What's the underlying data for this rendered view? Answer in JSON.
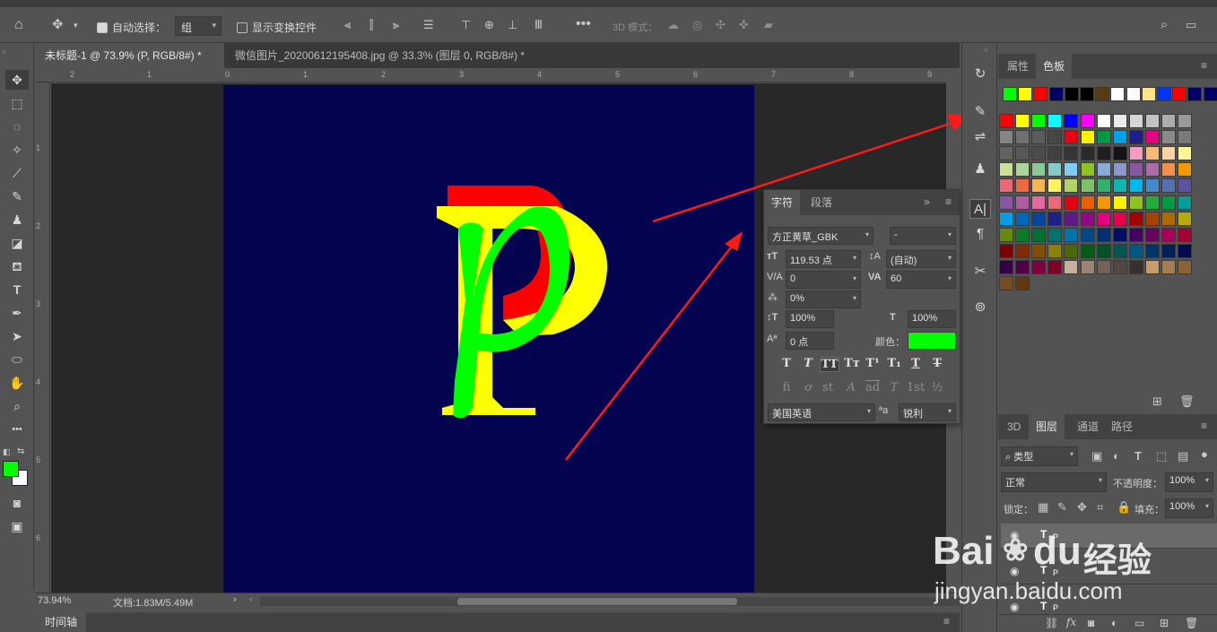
{
  "options_bar": {
    "auto_select_label": "自动选择：",
    "auto_select_value": "组",
    "show_transform_label": "显示变换控件",
    "mode_3d_label": "3D 模式："
  },
  "tabs": [
    {
      "label": "未标题-1 @ 73.9% (P, RGB/8#) *",
      "close": "×"
    },
    {
      "label": "微信图片_20200612195408.jpg @ 33.3% (图层 0, RGB/8#) *",
      "close": "×"
    }
  ],
  "rulers": {
    "h": [
      "2",
      "1",
      "0",
      "1",
      "2",
      "3",
      "4",
      "5",
      "6",
      "7",
      "8",
      "9"
    ],
    "v": [
      "1",
      "2",
      "3",
      "4",
      "5",
      "6"
    ]
  },
  "canvas": {
    "letter": "P",
    "bg_color": "#03034f",
    "colors": {
      "red": "#ff0000",
      "yellow": "#ffff00",
      "green": "#00ff00"
    }
  },
  "status": {
    "zoom": "73.94%",
    "doc": "文档:1.83M/5.49M",
    "arrow": "›"
  },
  "timeline": {
    "label": "时间轴"
  },
  "right_panel": {
    "top_tabs": [
      "属性",
      "色板"
    ],
    "layer_tabs": [
      "3D",
      "图层",
      "通道",
      "路径"
    ],
    "filter_label": "类型",
    "blend_mode": "正常",
    "opacity_label": "不透明度：",
    "opacity_value": "100%",
    "lock_label": "锁定：",
    "fill_label": "填充：",
    "fill_value": "100%",
    "fx_label": "fx"
  },
  "char_panel": {
    "tabs": [
      "字符",
      "段落"
    ],
    "font_family": "方正黄草_GBK",
    "font_style": "-",
    "size": "119.53 点",
    "leading": "(自动)",
    "kerning": "0",
    "tracking": "60",
    "scale_pct": "0%",
    "vscale": "100%",
    "hscale": "100%",
    "baseline": "0 点",
    "color_label": "颜色：",
    "color": "#00ff00",
    "language": "美国英语",
    "aa_label": "ªa",
    "aa_value": "锐利",
    "type_styles": [
      "T",
      "T",
      "TT",
      "Tт",
      "T¹",
      "T₁",
      "T",
      "T"
    ],
    "opentype": [
      "fi",
      "ơ",
      "st",
      "A",
      "ad",
      "T",
      "1st",
      "½"
    ]
  },
  "swatches": {
    "recent": [
      "#00ff00",
      "#ffff00",
      "#ff0000",
      "#000066",
      "#000000",
      "#000000",
      "#5a3a10",
      "#ffffff",
      "#ffffff",
      "#ffe58a",
      "#0033ff",
      "#ff0000",
      "#000066",
      "#000066"
    ],
    "grid": [
      [
        "#ff0000",
        "#ffff00",
        "#00ff00",
        "#00ffff",
        "#0000ff",
        "#ff00ff",
        "#ffffff",
        "#ebebeb",
        "#d6d6d6",
        "#c2c2c2",
        "#adadad",
        "#999999"
      ],
      [
        "#858585",
        "#707070",
        "#5c5c5c",
        "#474747",
        "#e60012",
        "#fff100",
        "#009944",
        "#00a0e9",
        "#1d2088",
        "#e4007f",
        "#8a8a8a",
        "#7a7a7a"
      ],
      [
        "#626262",
        "#575757",
        "#4c4c4c",
        "#404040",
        "#353535",
        "#2a2a2a",
        "#1f1f1f",
        "#141414",
        "#f19ec2",
        "#f7b977",
        "#fbd3a0",
        "#fff799"
      ],
      [
        "#cce198",
        "#acd598",
        "#89c997",
        "#84ccc9",
        "#7ecef4",
        "#8fc31f",
        "#88abda",
        "#8c97cb",
        "#8957a1",
        "#ac6aa8",
        "#f19149",
        "#f39800"
      ],
      [
        "#eb6877",
        "#ec6941",
        "#f8b551",
        "#fff45c",
        "#b3d465",
        "#80c269",
        "#32b16c",
        "#13b5b1",
        "#00b7ee",
        "#448aca",
        "#556fb5",
        "#5f52a0"
      ],
      [
        "#8957a1",
        "#ae5da1",
        "#ea68a2",
        "#eb6877",
        "#e60012",
        "#eb6100",
        "#f39800",
        "#fff100",
        "#8fc31f",
        "#22ac38",
        "#009944",
        "#009e96"
      ],
      [
        "#00a0e9",
        "#0068b7",
        "#00479d",
        "#1d2088",
        "#601986",
        "#920783",
        "#e4007f",
        "#e5004f",
        "#a40000",
        "#a84200",
        "#ac6a00",
        "#b7aa00"
      ],
      [
        "#638c0b",
        "#097c25",
        "#007130",
        "#00736d",
        "#0075a9",
        "#004986",
        "#003271",
        "#000e63",
        "#440062",
        "#6a005f",
        "#a4005b",
        "#a40035"
      ],
      [
        "#7d0000",
        "#7f2d00",
        "#834f00",
        "#8c8200",
        "#496a00",
        "#005e15",
        "#005324",
        "#005752",
        "#005982",
        "#003567",
        "#002157",
        "#000c4f"
      ],
      [
        "#350048",
        "#4f0046",
        "#7e003f",
        "#7e0025",
        "#c7b299",
        "#998675",
        "#736357",
        "#534741",
        "#37302d",
        "#c69c6d",
        "#a67c52",
        "#8c6239"
      ],
      [
        "#754c24",
        "#603913"
      ]
    ]
  },
  "layers": [
    {
      "type": "T",
      "name": "P"
    },
    {
      "type": "T",
      "name": "P"
    },
    {
      "type": "T",
      "name": "P"
    }
  ],
  "watermark": {
    "brand": "Bai",
    "brand2": "du",
    "cn": "经验",
    "url": "jingyan.baidu.com"
  }
}
